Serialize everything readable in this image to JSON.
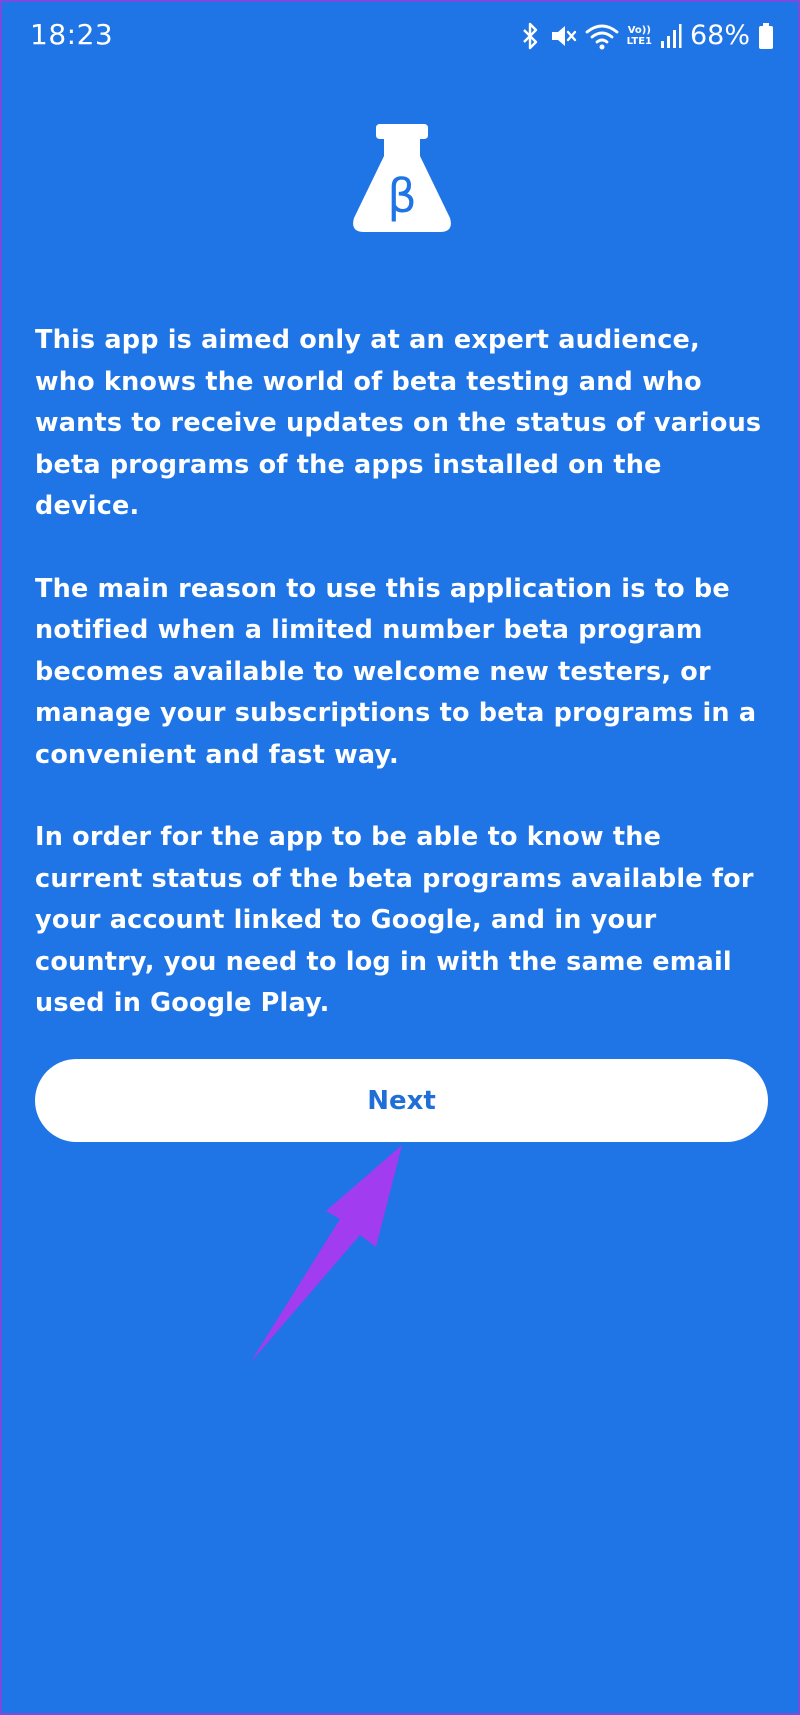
{
  "status_bar": {
    "time": "18:23",
    "volte_top": "Vo))",
    "volte_bottom": "LTE1",
    "battery": "68%",
    "icons": [
      "bluetooth-icon",
      "mute-icon",
      "wifi-icon",
      "signal-icon",
      "battery-icon"
    ]
  },
  "logo": {
    "icon": "beta-flask-icon",
    "symbol": "β"
  },
  "intro": {
    "paragraphs": [
      "This app is aimed only at an expert audience, who knows the world of beta testing and who wants to receive updates on the status of various beta programs of the apps installed on the device.",
      "The main reason to use this application is to be notified when a limited number beta program becomes available to welcome new testers, or manage your subscriptions to beta programs in a convenient and fast way.",
      "In order for the app to be able to know the current status of the beta programs available for your account linked to Google, and in your country, you need to log in with the same email used in Google Play."
    ]
  },
  "next_button": {
    "label": "Next"
  },
  "colors": {
    "background": "#1f74e6",
    "button_bg": "#ffffff",
    "button_text": "#1f6fd6",
    "annotation_arrow": "#a23cf0"
  }
}
